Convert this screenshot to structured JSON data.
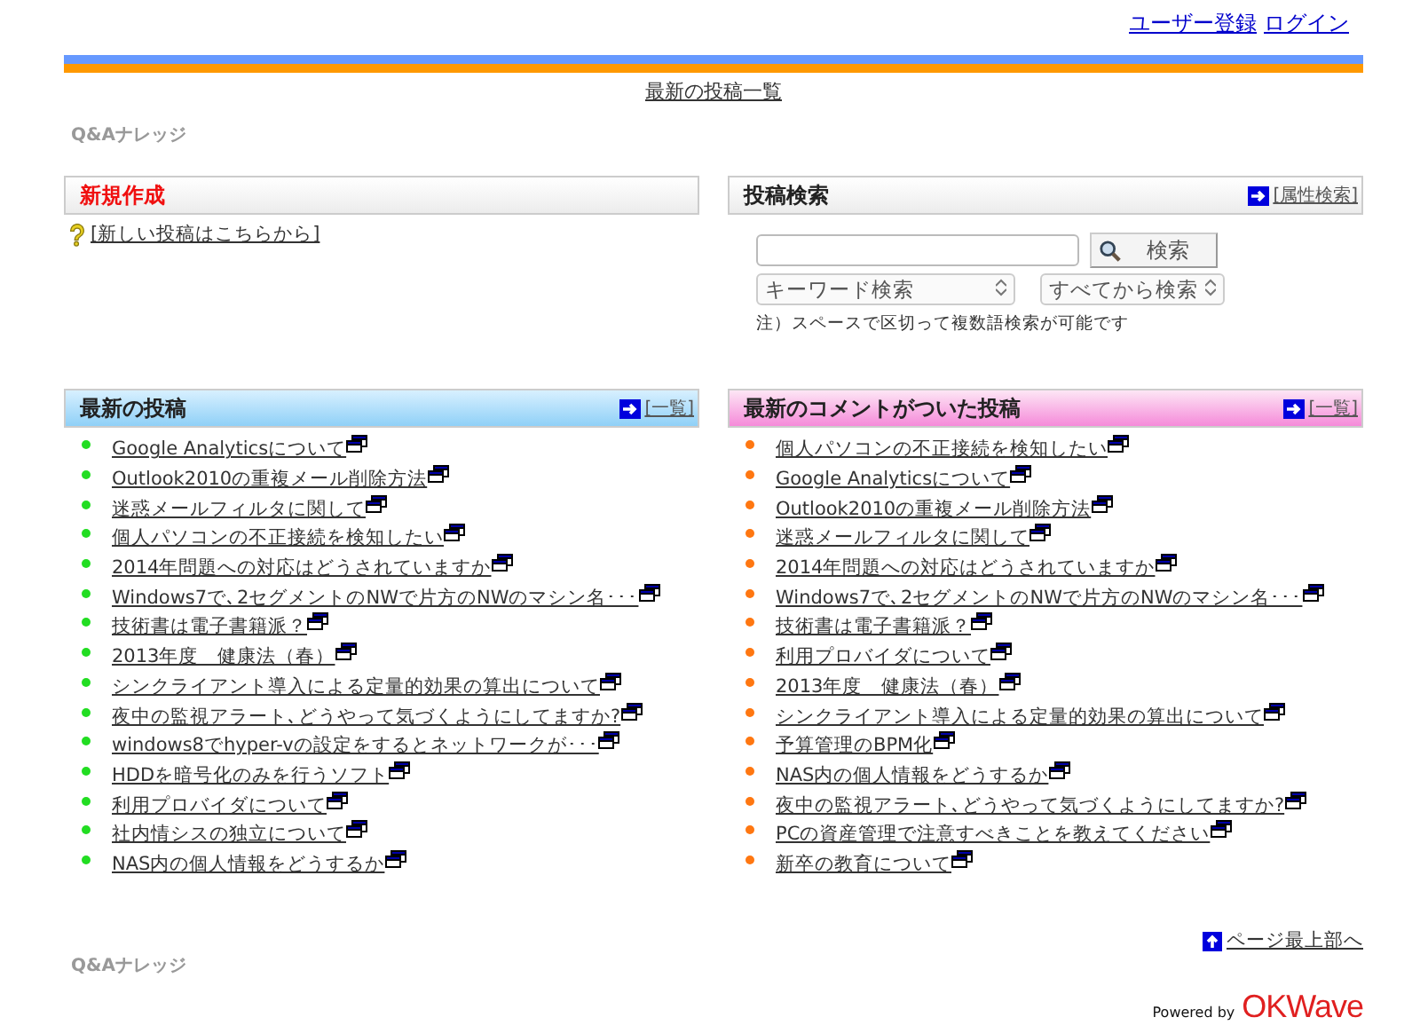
{
  "header": {
    "links": [
      "ユーザー登録",
      "ログイン"
    ],
    "nav_link": "最新の投稿一覧",
    "site_name": "Q&Aナレッジ"
  },
  "new_post": {
    "title": "新規作成",
    "link": "[新しい投稿はこちらから]"
  },
  "search": {
    "title": "投稿検索",
    "header_link": "[属性検索]",
    "button": "検索",
    "selects": [
      "キーワード検索",
      "すべてから検索"
    ],
    "note": "注）スペースで区切って複数語検索が可能です"
  },
  "panels": [
    {
      "kind": "posts",
      "title": "最新の投稿",
      "header_link": "[一覧]",
      "items": [
        "Google Analyticsについて",
        "Outlook2010の重複メール削除方法",
        "迷惑メールフィルタに関して",
        "個人パソコンの不正接続を検知したい",
        "2014年問題への対応はどうされていますか",
        "Windows7で､2セグメントのNWで片方のNWのマシン名･･･",
        "技術書は電子書籍派？",
        "2013年度　健康法（春）",
        "シンクライアント導入による定量的効果の算出について",
        "夜中の監視アラート､どうやって気づくようにしてますか?",
        "windows8でhyper-vの設定をするとネットワークが･･･",
        "HDDを暗号化のみを行うソフト",
        "利用プロバイダについて",
        "社内情シスの独立について",
        "NAS内の個人情報をどうするか"
      ]
    },
    {
      "kind": "comments",
      "title": "最新のコメントがついた投稿",
      "header_link": "[一覧]",
      "items": [
        "個人パソコンの不正接続を検知したい",
        "Google Analyticsについて",
        "Outlook2010の重複メール削除方法",
        "迷惑メールフィルタに関して",
        "2014年問題への対応はどうされていますか",
        "Windows7で､2セグメントのNWで片方のNWのマシン名･･･",
        "技術書は電子書籍派？",
        "利用プロバイダについて",
        "2013年度　健康法（春）",
        "シンクライアント導入による定量的効果の算出について",
        "予算管理のBPM化",
        "NAS内の個人情報をどうするか",
        "夜中の監視アラート､どうやって気づくようにしてますか?",
        "PCの資産管理で注意すべきことを教えてください",
        "新卒の教育について"
      ]
    }
  ],
  "footer": {
    "top_link": "ページ最上部へ",
    "site_name": "Q&Aナレッジ",
    "powered_by": "Powered by",
    "logo": "OKWave"
  }
}
